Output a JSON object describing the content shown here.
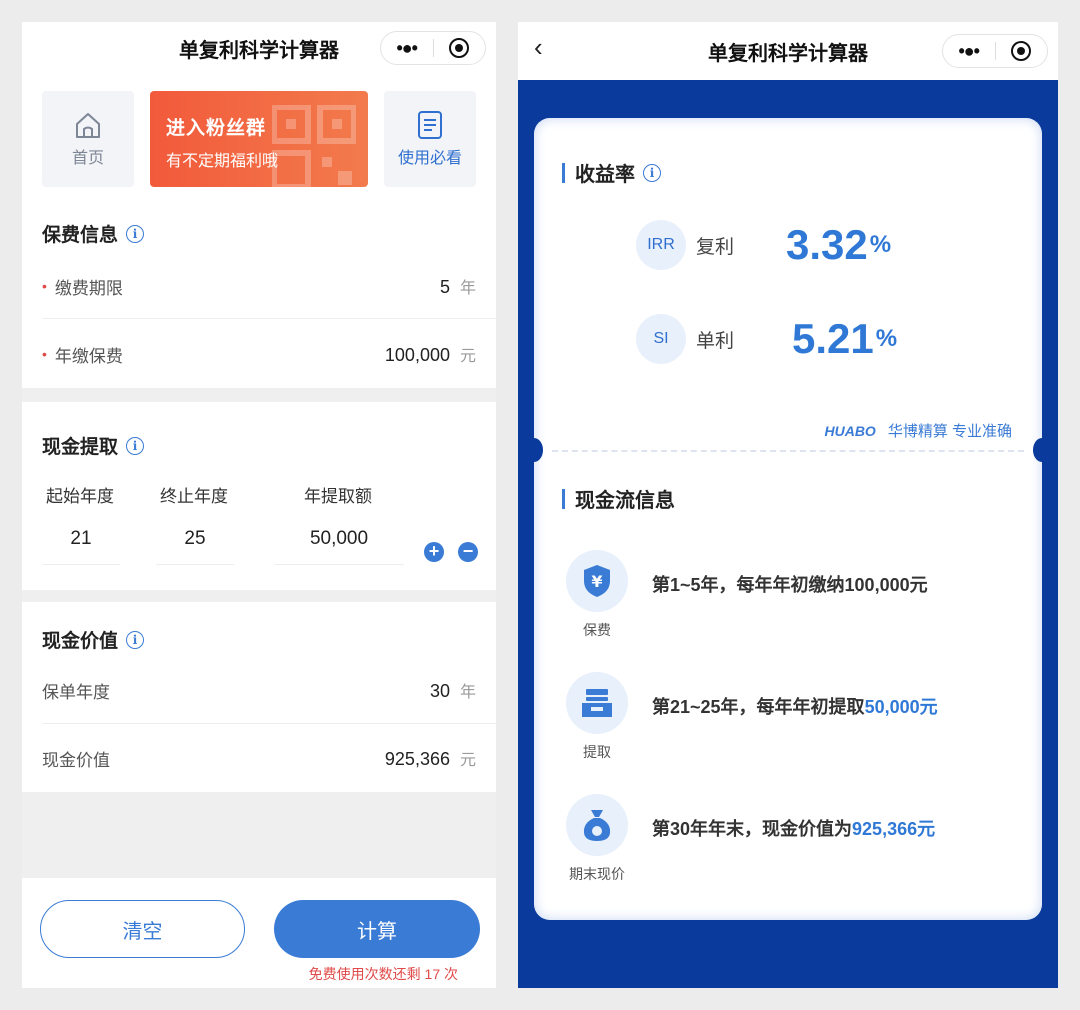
{
  "left": {
    "nav_title": "单复利科学计算器",
    "quick": {
      "home_label": "首页",
      "banner_line1": "进入粉丝群",
      "banner_line2": "有不定期福利哦",
      "usage_label": "使用必看"
    },
    "premium": {
      "title": "保费信息",
      "term_label": "缴费期限",
      "term_value": "5",
      "term_unit": "年",
      "annual_label": "年缴保费",
      "annual_value": "100,000",
      "annual_unit": "元"
    },
    "withdraw": {
      "title": "现金提取",
      "headers": [
        "起始年度",
        "终止年度",
        "年提取额"
      ],
      "values": [
        "21",
        "25",
        "50,000"
      ],
      "add_symbol": "+",
      "remove_symbol": "−"
    },
    "cash_value": {
      "title": "现金价值",
      "year_label": "保单年度",
      "year_value": "30",
      "year_unit": "年",
      "value_label": "现金价值",
      "value_value": "925,366",
      "value_unit": "元"
    },
    "buttons": {
      "clear": "清空",
      "calculate": "计算",
      "remaining": "免费使用次数还剩 17 次"
    }
  },
  "right": {
    "nav_title": "单复利科学计算器",
    "yield": {
      "title": "收益率",
      "irr_badge": "IRR",
      "irr_label": "复利",
      "irr_value": "3.32",
      "si_badge": "SI",
      "si_label": "单利",
      "si_value": "5.21",
      "percent": "%"
    },
    "brand": {
      "logo_text": "HUABO",
      "text": "华博精算 专业准确"
    },
    "cashflow": {
      "title": "现金流信息",
      "items": [
        {
          "caption": "保费",
          "text": "第1~5年，每年年初缴纳100,000元",
          "highlight": ""
        },
        {
          "caption": "提取",
          "text": "第21~25年，每年年初提取",
          "highlight": "50,000元"
        },
        {
          "caption": "期末现价",
          "text": "第30年年末，现金价值为",
          "highlight": "925,366元"
        }
      ]
    }
  },
  "colors": {
    "accent": "#3a7bd5",
    "right_bg": "#0a3a9c",
    "banner": "#f25a3b",
    "warning": "#e04a4a"
  },
  "icons": [
    "home-icon",
    "document-icon",
    "info-icon",
    "more-icon",
    "target-close-icon",
    "back-icon",
    "yen-shield-icon",
    "withdraw-tray-icon",
    "money-bag-icon"
  ]
}
